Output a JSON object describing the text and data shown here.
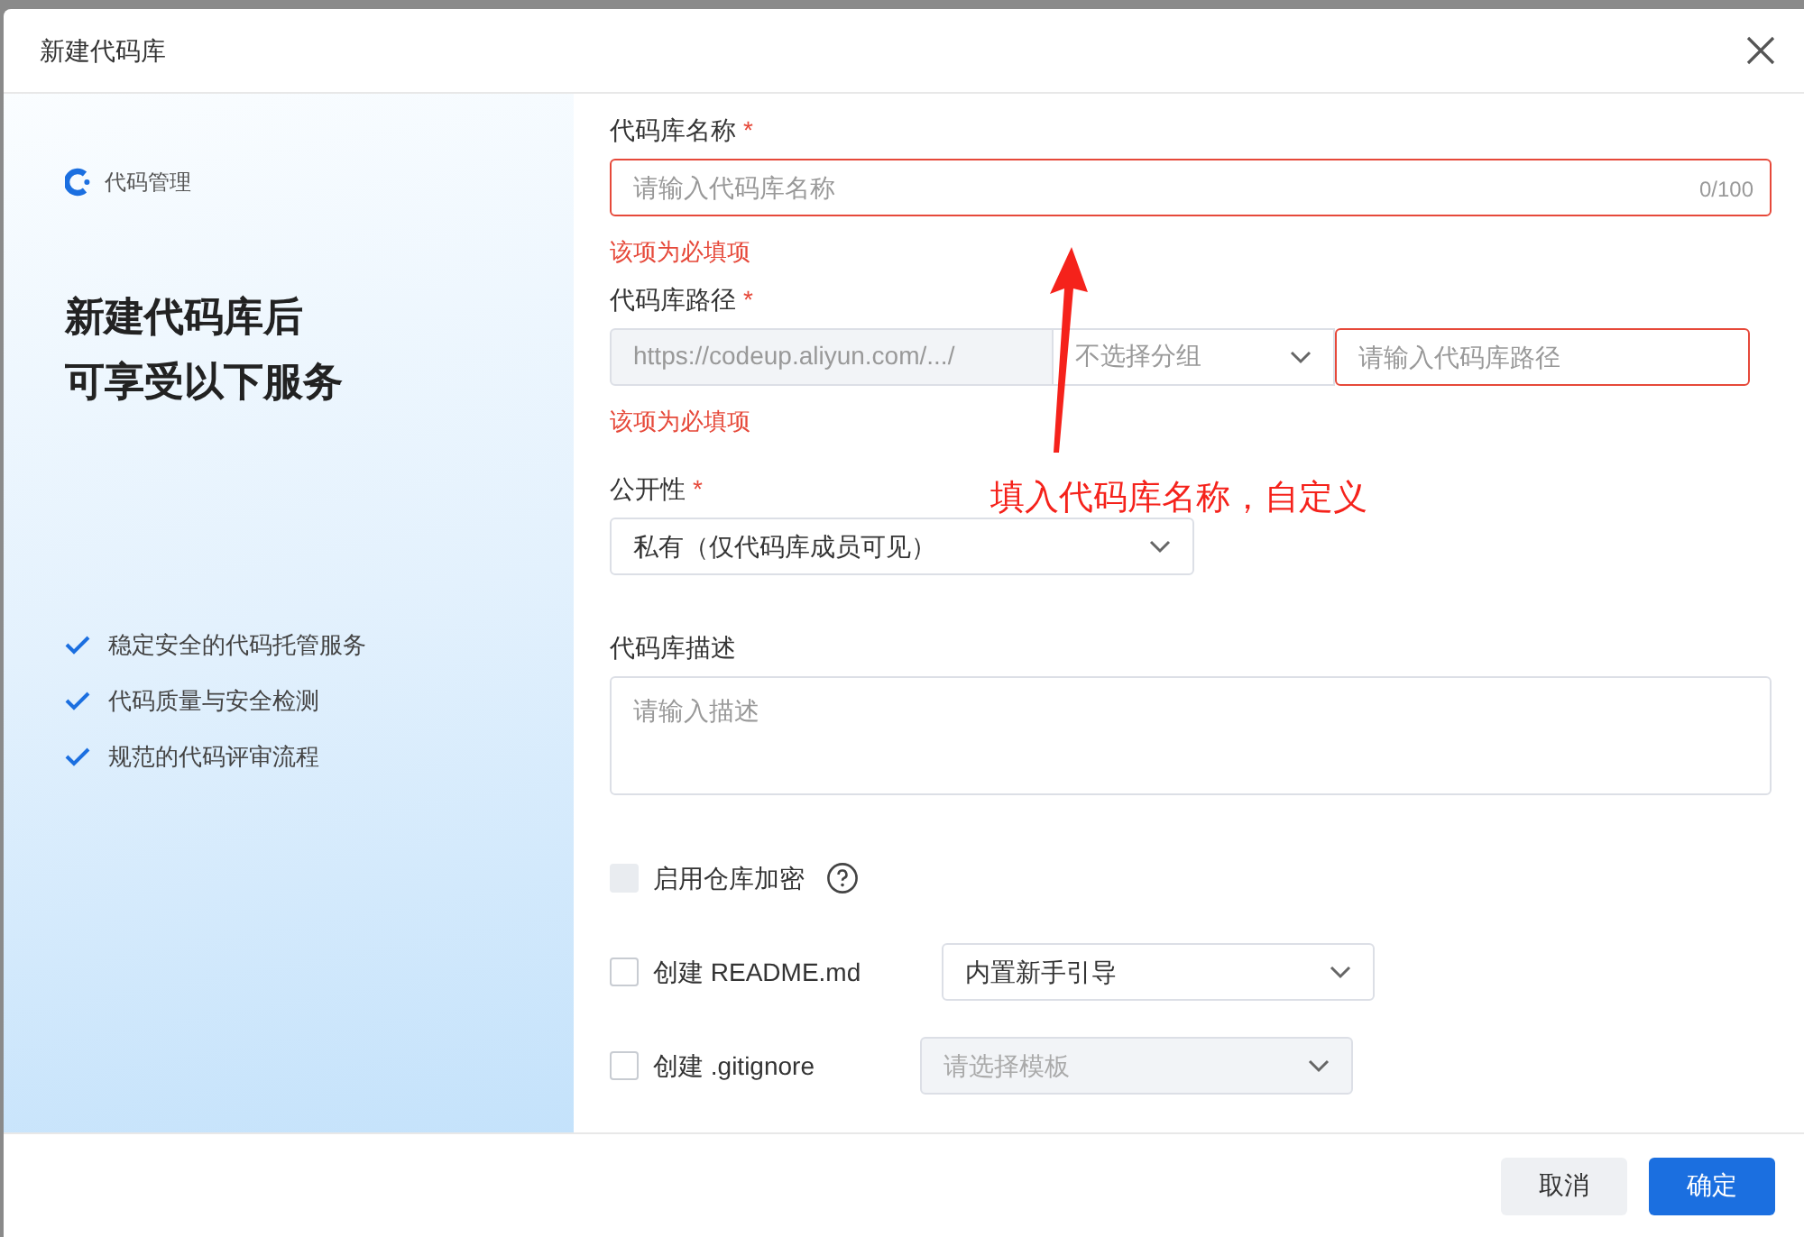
{
  "dialog": {
    "title": "新建代码库"
  },
  "sidebar": {
    "brand": "代码管理",
    "headline": [
      "新建代码库后",
      "可享受以下服务"
    ],
    "features": [
      "稳定安全的代码托管服务",
      "代码质量与安全检测",
      "规范的代码评审流程"
    ]
  },
  "form": {
    "name": {
      "label": "代码库名称",
      "required_mark": "*",
      "placeholder": "请输入代码库名称",
      "counter": "0/100",
      "error": "该项为必填项"
    },
    "path": {
      "label": "代码库路径",
      "required_mark": "*",
      "prefix": "https://codeup.aliyun.com/.../",
      "group_placeholder": "不选择分组",
      "placeholder": "请输入代码库路径",
      "error": "该项为必填项"
    },
    "visibility": {
      "label": "公开性",
      "required_mark": "*",
      "value": "私有（仅代码库成员可见）"
    },
    "description": {
      "label": "代码库描述",
      "placeholder": "请输入描述"
    },
    "options": [
      {
        "label": "启用仓库加密",
        "checked": false,
        "disabled": true,
        "help": true
      },
      {
        "label": "创建 README.md",
        "checked": false,
        "disabled": false,
        "help": false,
        "select": {
          "value": "内置新手引导",
          "disabled": false
        }
      },
      {
        "label": "创建 .gitignore",
        "checked": false,
        "disabled": false,
        "help": false,
        "select": {
          "placeholder": "请选择模板",
          "disabled": true
        }
      }
    ]
  },
  "annotation": {
    "text": "填入代码库名称，自定义"
  },
  "buttons": [
    {
      "label": "取消",
      "kind": "secondary"
    },
    {
      "label": "确定",
      "kind": "primary"
    }
  ]
}
